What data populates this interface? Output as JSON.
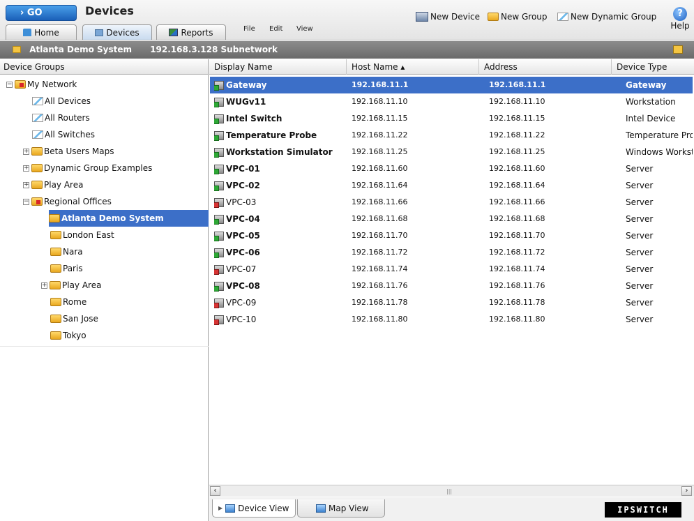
{
  "header": {
    "go_label": "GO",
    "title": "Devices",
    "tabs": [
      {
        "label": "Home",
        "icon": "home-icon"
      },
      {
        "label": "Devices",
        "icon": "devices-icon"
      },
      {
        "label": "Reports",
        "icon": "reports-icon"
      }
    ],
    "menu": [
      "File",
      "Edit",
      "View"
    ],
    "tools": [
      {
        "label": "New Device",
        "icon": "new-device-icon"
      },
      {
        "label": "New Group",
        "icon": "new-group-icon"
      },
      {
        "label": "New Dynamic Group",
        "icon": "new-dynamic-group-icon"
      }
    ],
    "help_label": "Help"
  },
  "subbar": {
    "group": "Atlanta Demo System",
    "subnet": "192.168.3.128 Subnetwork"
  },
  "tree": {
    "header": "Device Groups",
    "items": [
      {
        "label": "My Network",
        "level": 0,
        "expander": "−",
        "icon": "folder-red"
      },
      {
        "label": "All Devices",
        "level": 1,
        "icon": "dynamic"
      },
      {
        "label": "All Routers",
        "level": 1,
        "icon": "dynamic"
      },
      {
        "label": "All Switches",
        "level": 1,
        "icon": "dynamic"
      },
      {
        "label": "Beta Users Maps",
        "level": 1,
        "expander": "+",
        "icon": "folder"
      },
      {
        "label": "Dynamic Group Examples",
        "level": 1,
        "expander": "+",
        "icon": "folder"
      },
      {
        "label": "Play Area",
        "level": 1,
        "expander": "+",
        "icon": "folder"
      },
      {
        "label": "Regional Offices",
        "level": 1,
        "expander": "−",
        "icon": "folder-red"
      },
      {
        "label": "Atlanta Demo System",
        "level": 2,
        "icon": "folder",
        "selected": true
      },
      {
        "label": "London East",
        "level": 2,
        "icon": "folder"
      },
      {
        "label": "Nara",
        "level": 2,
        "icon": "folder"
      },
      {
        "label": "Paris",
        "level": 2,
        "icon": "folder"
      },
      {
        "label": "Play Area",
        "level": 2,
        "expander": "+",
        "icon": "folder"
      },
      {
        "label": "Rome",
        "level": 2,
        "icon": "folder"
      },
      {
        "label": "San Jose",
        "level": 2,
        "icon": "folder"
      },
      {
        "label": "Tokyo",
        "level": 2,
        "icon": "folder"
      }
    ]
  },
  "grid": {
    "columns": [
      "Display Name",
      "Host Name ▴",
      "Address",
      "Device Type"
    ],
    "rows": [
      {
        "name": "Gateway",
        "host": "192.168.11.1",
        "address": "192.168.11.1",
        "type": "Gateway",
        "bold": true,
        "selected": true,
        "status": "green"
      },
      {
        "name": "WUGv11",
        "host": "192.168.11.10",
        "address": "192.168.11.10",
        "type": "Workstation",
        "bold": true,
        "status": "green"
      },
      {
        "name": "Intel Switch",
        "host": "192.168.11.15",
        "address": "192.168.11.15",
        "type": "Intel Device",
        "bold": true,
        "status": "green"
      },
      {
        "name": "Temperature Probe",
        "host": "192.168.11.22",
        "address": "192.168.11.22",
        "type": "Temperature Prob",
        "bold": true,
        "status": "green"
      },
      {
        "name": "Workstation Simulator",
        "host": "192.168.11.25",
        "address": "192.168.11.25",
        "type": "Windows Workstat",
        "bold": true,
        "status": "green"
      },
      {
        "name": "VPC-01",
        "host": "192.168.11.60",
        "address": "192.168.11.60",
        "type": "Server",
        "bold": true,
        "status": "green"
      },
      {
        "name": "VPC-02",
        "host": "192.168.11.64",
        "address": "192.168.11.64",
        "type": "Server",
        "bold": true,
        "status": "green"
      },
      {
        "name": "VPC-03",
        "host": "192.168.11.66",
        "address": "192.168.11.66",
        "type": "Server",
        "bold": false,
        "status": "red"
      },
      {
        "name": "VPC-04",
        "host": "192.168.11.68",
        "address": "192.168.11.68",
        "type": "Server",
        "bold": true,
        "status": "green"
      },
      {
        "name": "VPC-05",
        "host": "192.168.11.70",
        "address": "192.168.11.70",
        "type": "Server",
        "bold": true,
        "status": "green"
      },
      {
        "name": "VPC-06",
        "host": "192.168.11.72",
        "address": "192.168.11.72",
        "type": "Server",
        "bold": true,
        "status": "green"
      },
      {
        "name": "VPC-07",
        "host": "192.168.11.74",
        "address": "192.168.11.74",
        "type": "Server",
        "bold": false,
        "status": "red"
      },
      {
        "name": "VPC-08",
        "host": "192.168.11.76",
        "address": "192.168.11.76",
        "type": "Server",
        "bold": true,
        "status": "green"
      },
      {
        "name": "VPC-09",
        "host": "192.168.11.78",
        "address": "192.168.11.78",
        "type": "Server",
        "bold": false,
        "status": "red"
      },
      {
        "name": "VPC-10",
        "host": "192.168.11.80",
        "address": "192.168.11.80",
        "type": "Server",
        "bold": false,
        "status": "red"
      }
    ]
  },
  "view_tabs": [
    {
      "label": "Device View",
      "icon": "device-view-icon"
    },
    {
      "label": "Map View",
      "icon": "map-view-icon"
    }
  ],
  "logo": "IPSWITCH"
}
